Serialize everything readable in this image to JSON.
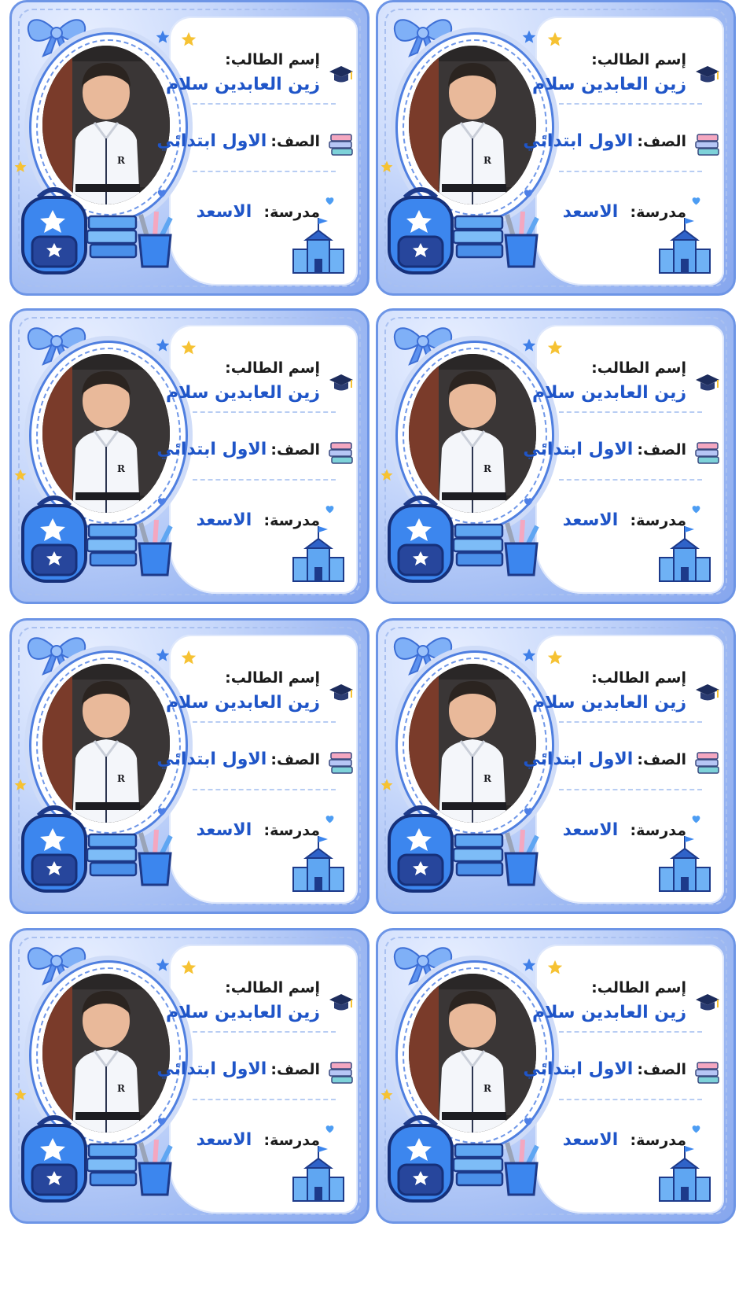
{
  "labels": [
    {
      "name_key": "إسم الطالب:",
      "name_value": "زين العابدين سلام",
      "grade_key": "الصف:",
      "grade_value": "الاول ابتدائي",
      "school_key": "مدرسة:",
      "school_value": "الاسعد"
    },
    {
      "name_key": "إسم الطالب:",
      "name_value": "زين العابدين سلام",
      "grade_key": "الصف:",
      "grade_value": "الاول ابتدائي",
      "school_key": "مدرسة:",
      "school_value": "الاسعد"
    },
    {
      "name_key": "إسم الطالب:",
      "name_value": "زين العابدين سلام",
      "grade_key": "الصف:",
      "grade_value": "الاول ابتدائي",
      "school_key": "مدرسة:",
      "school_value": "الاسعد"
    },
    {
      "name_key": "إسم الطالب:",
      "name_value": "زين العابدين سلام",
      "grade_key": "الصف:",
      "grade_value": "الاول ابتدائي",
      "school_key": "مدرسة:",
      "school_value": "الاسعد"
    },
    {
      "name_key": "إسم الطالب:",
      "name_value": "زين العابدين سلام",
      "grade_key": "الصف:",
      "grade_value": "الاول ابتدائي",
      "school_key": "مدرسة:",
      "school_value": "الاسعد"
    },
    {
      "name_key": "إسم الطالب:",
      "name_value": "زين العابدين سلام",
      "grade_key": "الصف:",
      "grade_value": "الاول ابتدائي",
      "school_key": "مدرسة:",
      "school_value": "الاسعد"
    },
    {
      "name_key": "إسم الطالب:",
      "name_value": "زين العابدين سلام",
      "grade_key": "الصف:",
      "grade_value": "الاول ابتدائي",
      "school_key": "مدرسة:",
      "school_value": "الاسعد"
    },
    {
      "name_key": "إسم الطالب:",
      "name_value": "زين العابدين سلام",
      "grade_key": "الصف:",
      "grade_value": "الاول ابتدائي",
      "school_key": "مدرسة:",
      "school_value": "الاسعد"
    }
  ],
  "photo_shirt_letter": "R",
  "colors": {
    "accent": "#1f55c8",
    "frame": "#6d95e6",
    "key_text": "#1b1b1b"
  },
  "icons": [
    "bow-icon",
    "graduation-cap-icon",
    "books-icon",
    "school-building-icon",
    "backpack-icon",
    "pencil-cup-icon",
    "star-icon",
    "heart-icon"
  ]
}
